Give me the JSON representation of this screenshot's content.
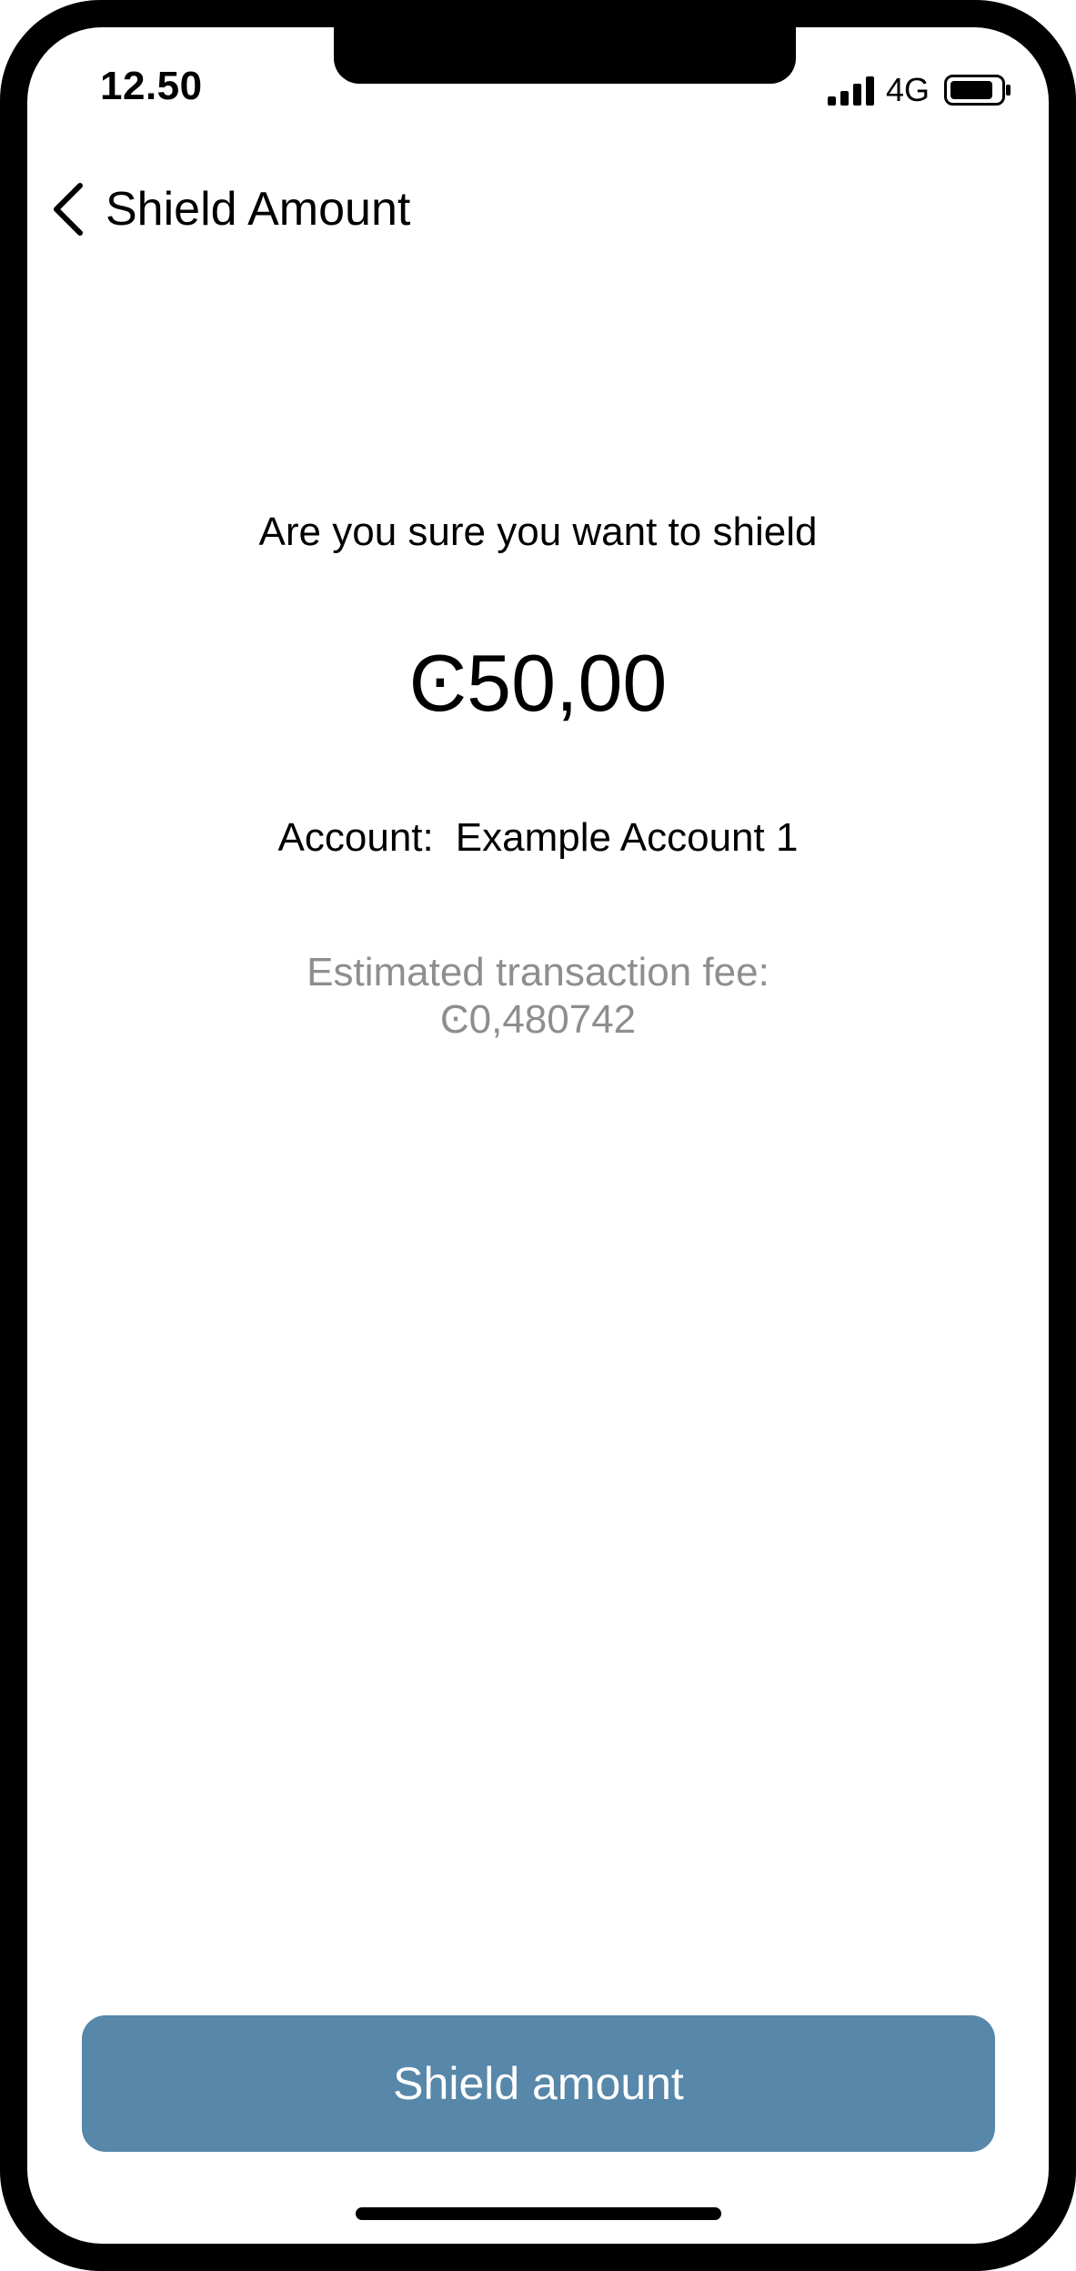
{
  "status_bar": {
    "time": "12.50",
    "network": "4G",
    "icons": [
      "signal-icon",
      "battery-icon"
    ]
  },
  "header": {
    "back_icon": "chevron-left-icon",
    "title": "Shield Amount"
  },
  "confirmation": {
    "question": "Are you sure you want to shield",
    "amount": "Ͼ50,00",
    "account_label": "Account:",
    "account_name": "Example Account 1",
    "fee_label": "Estimated transaction fee:",
    "fee_value": "Ͼ0,480742"
  },
  "actions": {
    "shield_button_label": "Shield amount"
  },
  "colors": {
    "primary_button": "#5787a9",
    "secondary_text": "#8e8e8e",
    "text": "#000000",
    "background": "#ffffff"
  }
}
